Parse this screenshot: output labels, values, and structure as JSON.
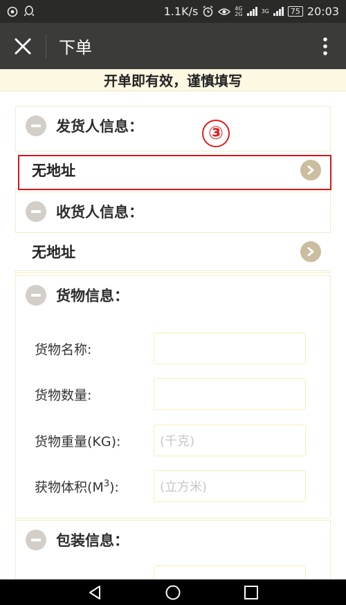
{
  "status_bar": {
    "speed": "1.1K/s",
    "net1_top": "4G",
    "net1_bottom": "2G",
    "net2": "3G",
    "battery": "75",
    "time": "20:03"
  },
  "header": {
    "title": "下单"
  },
  "notice": "开单即有效，谨慎填写",
  "annotation": {
    "step": "③"
  },
  "sections": {
    "sender": {
      "title": "发货人信息：",
      "address": "无地址"
    },
    "receiver": {
      "title": "收货人信息：",
      "address": "无地址"
    },
    "goods": {
      "title": "货物信息：",
      "fields": {
        "name_label": "货物名称:",
        "name_value": "",
        "quantity_label": "货物数量:",
        "quantity_value": "",
        "weight_label": "货物重量(KG):",
        "weight_placeholder": "(千克)",
        "volume_label_pre": "获物体积(M",
        "volume_label_sup": "3",
        "volume_label_post": "):",
        "volume_placeholder": "(立方米)"
      }
    },
    "packaging": {
      "title": "包装信息："
    }
  },
  "colors": {
    "header_bg": "#3b3b39",
    "accent_red": "#d8141b",
    "notice_bg": "#fdf8e2",
    "input_border": "#f6eeb6"
  }
}
